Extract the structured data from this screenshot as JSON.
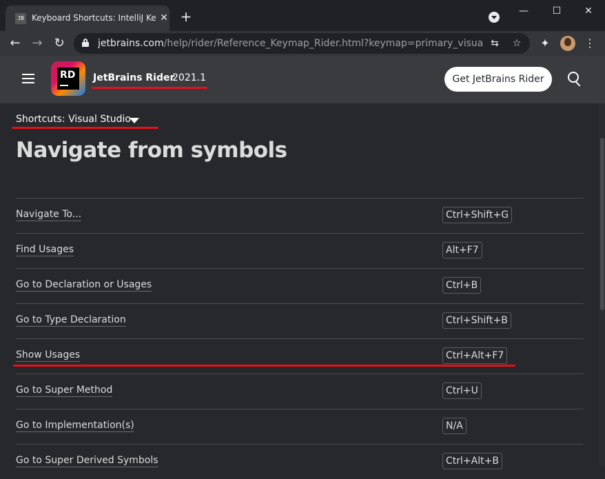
{
  "browser": {
    "tab_title": "Keyboard Shortcuts: IntelliJ Keym",
    "tab_favicon_text": "JB",
    "tab_close": "✕",
    "new_tab": "+",
    "window": {
      "minimize": "—",
      "maximize": "☐",
      "close": "✕"
    },
    "url_host": "jetbrains.com",
    "url_path": "/help/rider/Reference_Keymap_Rider.html?keymap=primary_visual_studio...",
    "back": "←",
    "forward": "→",
    "reload": "↻",
    "translate": "⇆",
    "star": "☆",
    "extensions": "✦",
    "menu": "⋮"
  },
  "site": {
    "brand": "JetBrains Rider",
    "version": "2021.1",
    "logo_text": "RD",
    "cta": "Get JetBrains Rider"
  },
  "page": {
    "keymap_label": "Shortcuts: Visual Studio",
    "title": "Navigate from symbols",
    "rows": [
      {
        "action": "Navigate To...",
        "key": "Ctrl+Shift+G"
      },
      {
        "action": "Find Usages",
        "key": "Alt+F7"
      },
      {
        "action": "Go to Declaration or Usages",
        "key": "Ctrl+B"
      },
      {
        "action": "Go to Type Declaration",
        "key": "Ctrl+Shift+B"
      },
      {
        "action": "Show Usages",
        "key": "Ctrl+Alt+F7"
      },
      {
        "action": "Go to Super Method",
        "key": "Ctrl+U"
      },
      {
        "action": "Go to Implementation(s)",
        "key": "N/A"
      },
      {
        "action": "Go to Super Derived Symbols",
        "key": "Ctrl+Alt+B"
      }
    ]
  },
  "colors": {
    "annotation": "#e8101a",
    "page_bg": "#27282c",
    "header_bg": "#3a3b3f"
  }
}
